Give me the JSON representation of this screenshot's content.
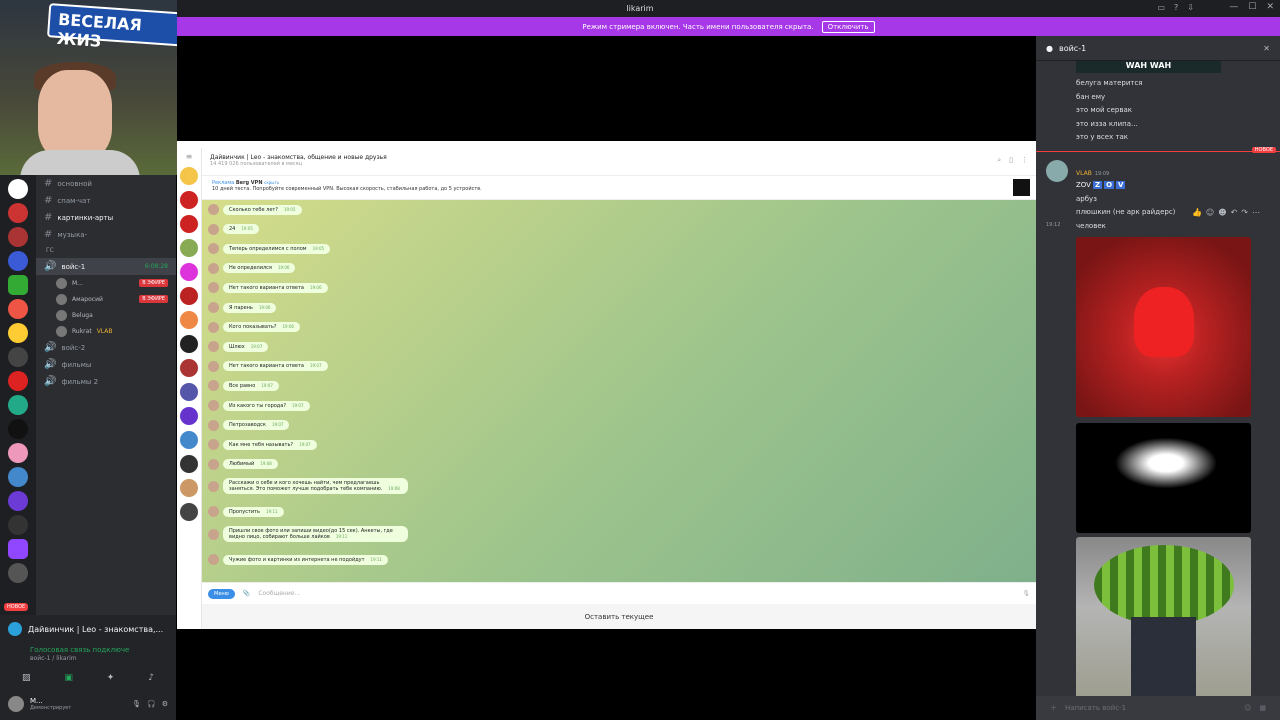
{
  "window": {
    "title": "likarim"
  },
  "streamer_bar": {
    "text": "Режим стримера включен. Часть имени пользователя скрыта.",
    "button": "Отключить"
  },
  "webcam": {
    "sign_text": "ВЕСЕЛАЯ ЖИЗ"
  },
  "channels": {
    "items": [
      {
        "name": "основной"
      },
      {
        "name": "спам-чат"
      },
      {
        "name": "картинки-арты"
      },
      {
        "name": "музыка-"
      }
    ],
    "category_gs": "ГС",
    "voice_active": {
      "name": "войс-1",
      "time": "6:08:28"
    },
    "voice_users": [
      {
        "name": "М...",
        "badge": "В ЭФИРЕ"
      },
      {
        "name": "Амаросий",
        "badge": "В ЭФИРЕ"
      },
      {
        "name": "Beluga",
        "badge": ""
      },
      {
        "name": "Rukrat",
        "badge": "VLAB"
      }
    ],
    "voice_other": [
      {
        "name": "войс-2"
      },
      {
        "name": "фильмы"
      },
      {
        "name": "фильмы 2"
      }
    ]
  },
  "bottom": {
    "activity": "Дайвинчик | Leo - знакомства,...",
    "voice_status": "Голосовая связь подключе",
    "voice_sub": "войс-1 / likarim",
    "user": "М...",
    "user_sub": "Демонстрирует",
    "new_badge": "НОВОЕ"
  },
  "telegram": {
    "chat_title": "Дайвинчик | Leo - знакомства, общение и новые друзья",
    "chat_sub": "14 419 026 пользователей в месяц",
    "ad_label": "Реклама",
    "ad_name": "Berg VPN",
    "ad_hide": "скрыть",
    "ad_text": "10 дней теста. Попробуйте современный VPN. Высокая скорость, стабильная работа, до 5 устройств.",
    "messages": [
      {
        "text": "Сколько тебе лет?",
        "time": "19:05"
      },
      {
        "text": "24",
        "time": "19:05"
      },
      {
        "text": "Теперь определимся с полом",
        "time": "19:05"
      },
      {
        "text": "Не определился",
        "time": "19:06"
      },
      {
        "text": "Нет такого варианта ответа",
        "time": "19:06"
      },
      {
        "text": "Я парень",
        "time": "19:06"
      },
      {
        "text": "Кого показывать?",
        "time": "19:06"
      },
      {
        "text": "Шлюх",
        "time": "19:07"
      },
      {
        "text": "Нет такого варианта ответа",
        "time": "19:07"
      },
      {
        "text": "Все равно",
        "time": "19:07"
      },
      {
        "text": "Из какого ты города?",
        "time": "19:07"
      },
      {
        "text": "Петрозаводск",
        "time": "19:07"
      },
      {
        "text": "Как мне тебя называть?",
        "time": "19:07"
      },
      {
        "text": "Любимый",
        "time": "19:08"
      },
      {
        "text": "Расскажи о себе и кого хочешь найти, чем предлагаешь заняться. Это поможет лучше подобрать тебе компанию.",
        "time": "19:08"
      },
      {
        "text": "Пропустить",
        "time": "19:11"
      },
      {
        "text": "Пришли свое фото или запиши видео(до 15 сек). Анкеты, где видно лицо, собирают больше лайков",
        "time": "19:11"
      },
      {
        "text": "Чужие фото и картинки из интернета не подойдут",
        "time": "19:11"
      }
    ],
    "menu_btn": "Меню",
    "input_placeholder": "Сообщение...",
    "keep_btn": "Оставить текущее"
  },
  "right_panel": {
    "title": "войс-1",
    "wah": "WAH WAH",
    "lines": [
      "белуга матерится",
      "бан ему",
      "это мой сервак",
      "это изза клипа...",
      "это у всех так"
    ],
    "new_label": "НОВОЕ",
    "author_tag": "VLAB",
    "author_time": "19:09",
    "zov_prefix": "ZOV",
    "zov_letters": [
      "Z",
      "O",
      "V"
    ],
    "msgs2": [
      "арбуз",
      "плюшкин (не арк райдерс)",
      "человек"
    ],
    "time_side": "19:12",
    "input_placeholder": "Написать войс-1"
  },
  "colors": {
    "accent": "#a638e8",
    "discord_bg": "#313338",
    "telegram_bubble": "#effedd"
  }
}
